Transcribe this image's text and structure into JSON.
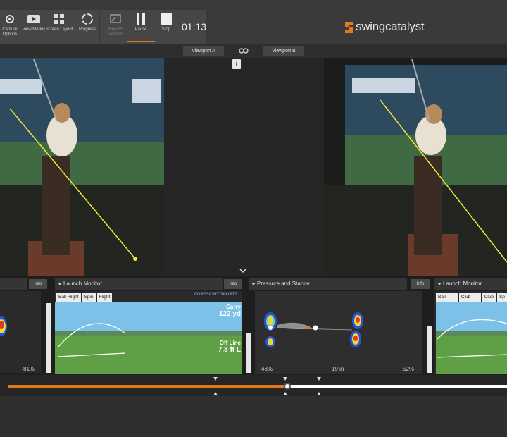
{
  "toolbar": {
    "capture_label": "Capture Options",
    "view_modes_label": "View Modes",
    "screen_layout_label": "Screen Layout",
    "progress_label": "Progress",
    "record_lesson_label": "Record Lesson",
    "pause_label": "Pause",
    "stop_label": "Stop",
    "timer": "01:13"
  },
  "brand": {
    "name": "swingcatalyst",
    "accent": "#e07a1e"
  },
  "viewports": {
    "a_label": "Viewport A",
    "b_label": "Viewport B",
    "link_icon": "link-icon",
    "info_icon": "info-icon"
  },
  "panel1": {
    "pct": "81%",
    "info": "Info"
  },
  "launch_a": {
    "title": "Launch Monitor",
    "info": "Info",
    "tabs": [
      "Ball Flight",
      "Spin",
      "Flight"
    ],
    "brand_watermark": "FORESIGHT SPORTS",
    "carry_label": "Carry",
    "carry_value": "122 yd",
    "offline_label": "Off Line",
    "offline_value": "7.8 ft L"
  },
  "pressure": {
    "title": "Pressure and Stance",
    "info": "Info",
    "left_pct": "48%",
    "stance": "19 in",
    "right_pct": "52%"
  },
  "launch_b": {
    "title": "Launch Monitor",
    "tabs": [
      "Ball Flight",
      "Club Path",
      "Club",
      "Sp"
    ]
  },
  "timeline": {
    "progress": 0.56,
    "accent": "#e07a1e"
  }
}
